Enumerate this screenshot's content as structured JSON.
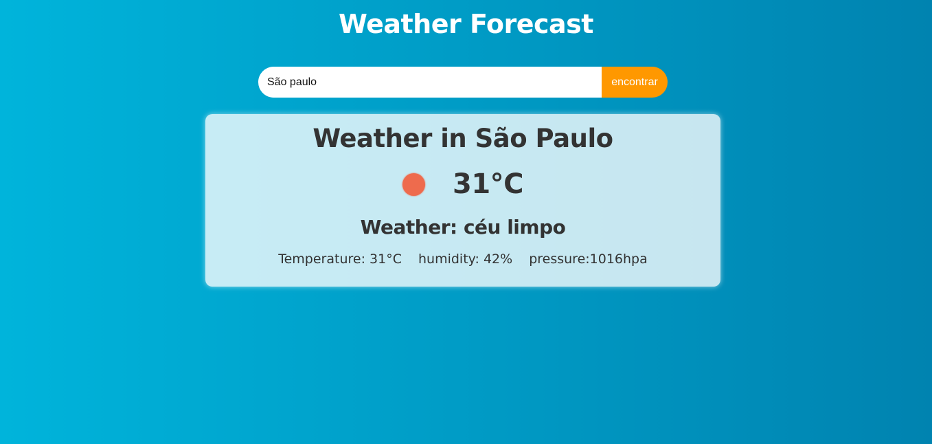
{
  "header": {
    "title": "Weather Forecast"
  },
  "search": {
    "value": "São paulo",
    "button_label": "encontrar"
  },
  "weather": {
    "title": "Weather in São Paulo",
    "icon": "sun-icon",
    "icon_color": "#ee6b4d",
    "temperature": "31°C",
    "condition": "Weather: céu limpo",
    "details": {
      "temperature": "Temperature: 31°C",
      "humidity": "humidity: 42%",
      "pressure": "pressure:1016hpa"
    }
  },
  "colors": {
    "background_start": "#00b4db",
    "background_end": "#0083b0",
    "accent": "#ff9800",
    "text": "#333333"
  }
}
